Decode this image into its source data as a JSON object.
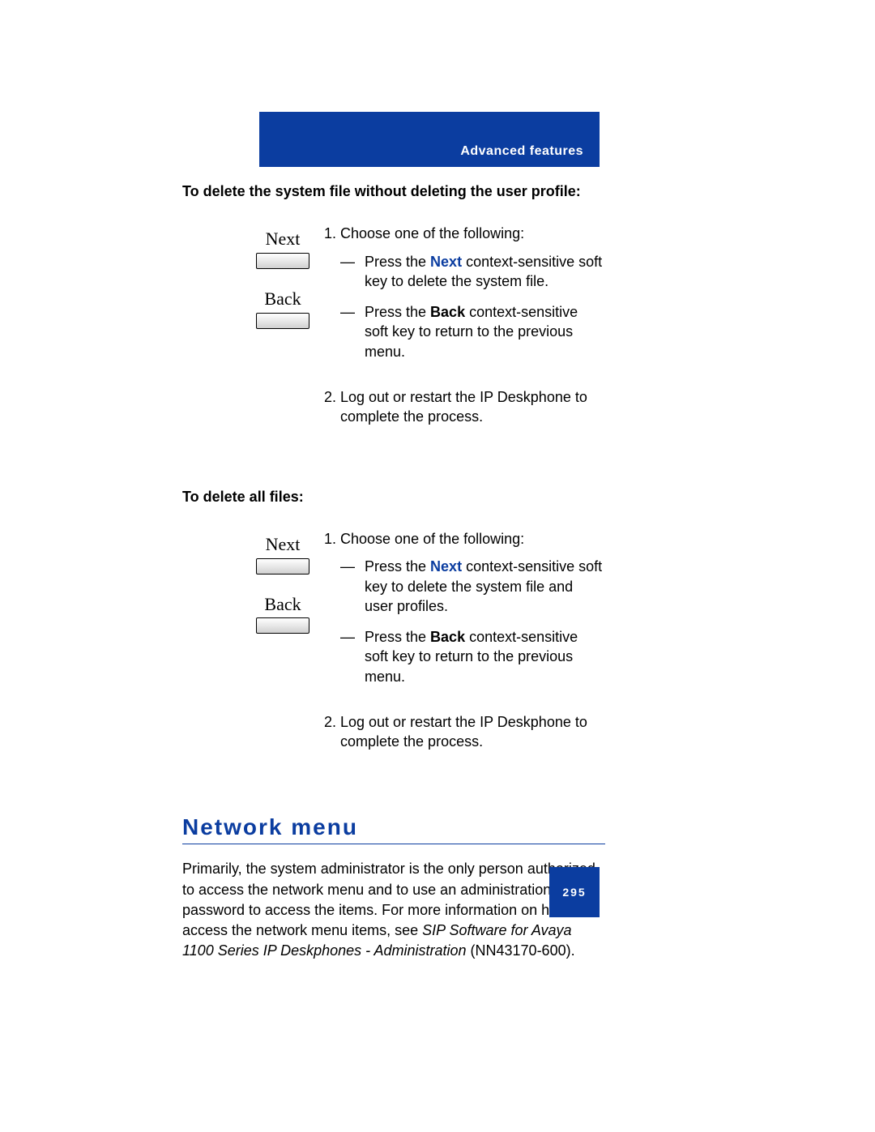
{
  "header": {
    "section_label": "Advanced features"
  },
  "procA": {
    "title": "To delete the system file without deleting the user profile:",
    "keys": {
      "next": "Next",
      "back": "Back"
    },
    "steps": {
      "s1_intro": "Choose one of the following:",
      "s1_a_pre": "Press the ",
      "s1_a_key": "Next",
      "s1_a_post": " context-sensitive soft key to delete the system file.",
      "s1_b_pre": "Press the ",
      "s1_b_key": "Back",
      "s1_b_post": " context-sensitive soft key to return to the previous menu.",
      "s2": "Log out or restart the IP Deskphone to complete the process."
    }
  },
  "procB": {
    "title": "To delete all files:",
    "keys": {
      "next": "Next",
      "back": "Back"
    },
    "steps": {
      "s1_intro": "Choose one of the following:",
      "s1_a_pre": "Press the ",
      "s1_a_key": "Next",
      "s1_a_post": " context-sensitive soft key to delete the system file and user profiles.",
      "s1_b_pre": "Press the ",
      "s1_b_key": "Back",
      "s1_b_post": " context-sensitive soft key to return to the previous menu.",
      "s2": "Log out or restart the IP Deskphone to complete the process."
    }
  },
  "section": {
    "heading": "Network menu",
    "para_pre": "Primarily, the system administrator is the only person authorized to access the network menu and to use an administration password to access the items. For more information on how to access the network menu items, see ",
    "para_ital": "SIP Software for Avaya 1100 Series IP Deskphones - Administration",
    "para_post": " (NN43170-600)."
  },
  "page_number": "295"
}
